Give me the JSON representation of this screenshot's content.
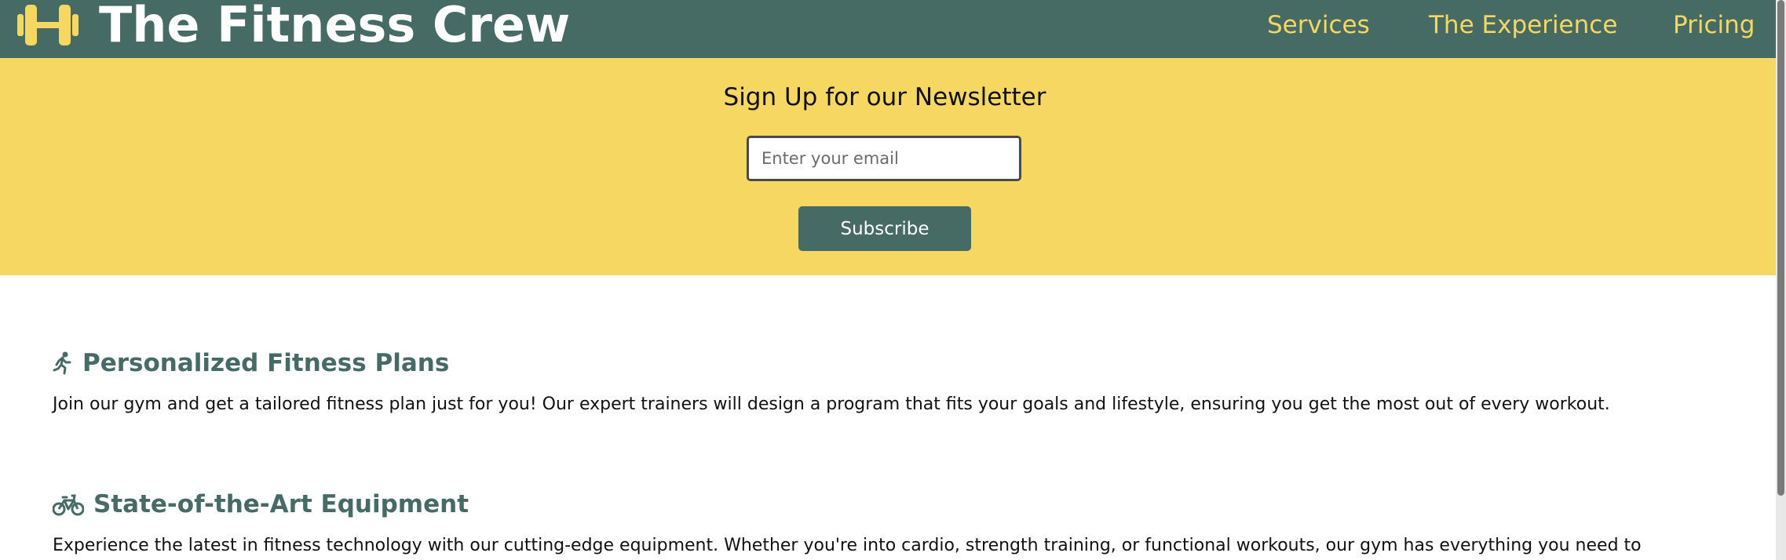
{
  "header": {
    "brand": "The Fitness Crew",
    "logo_icon": "dumbbell-icon",
    "nav": [
      {
        "label": "Services"
      },
      {
        "label": "The Experience"
      },
      {
        "label": "Pricing"
      }
    ]
  },
  "newsletter": {
    "title": "Sign Up for our Newsletter",
    "email_placeholder": "Enter your email",
    "email_value": "",
    "subscribe_label": "Subscribe"
  },
  "features": [
    {
      "icon": "running-person-icon",
      "title": "Personalized Fitness Plans",
      "text": "Join our gym and get a tailored fitness plan just for you! Our expert trainers will design a program that fits your goals and lifestyle, ensuring you get the most out of every workout."
    },
    {
      "icon": "bicycle-icon",
      "title": "State-of-the-Art Equipment",
      "text": "Experience the latest in fitness technology with our cutting-edge equipment. Whether you're into cardio, strength training, or functional workouts, our gym has everything you need to"
    }
  ],
  "colors": {
    "primary": "#466a64",
    "accent": "#f5d762",
    "text": "#111111",
    "background": "#ffffff"
  }
}
